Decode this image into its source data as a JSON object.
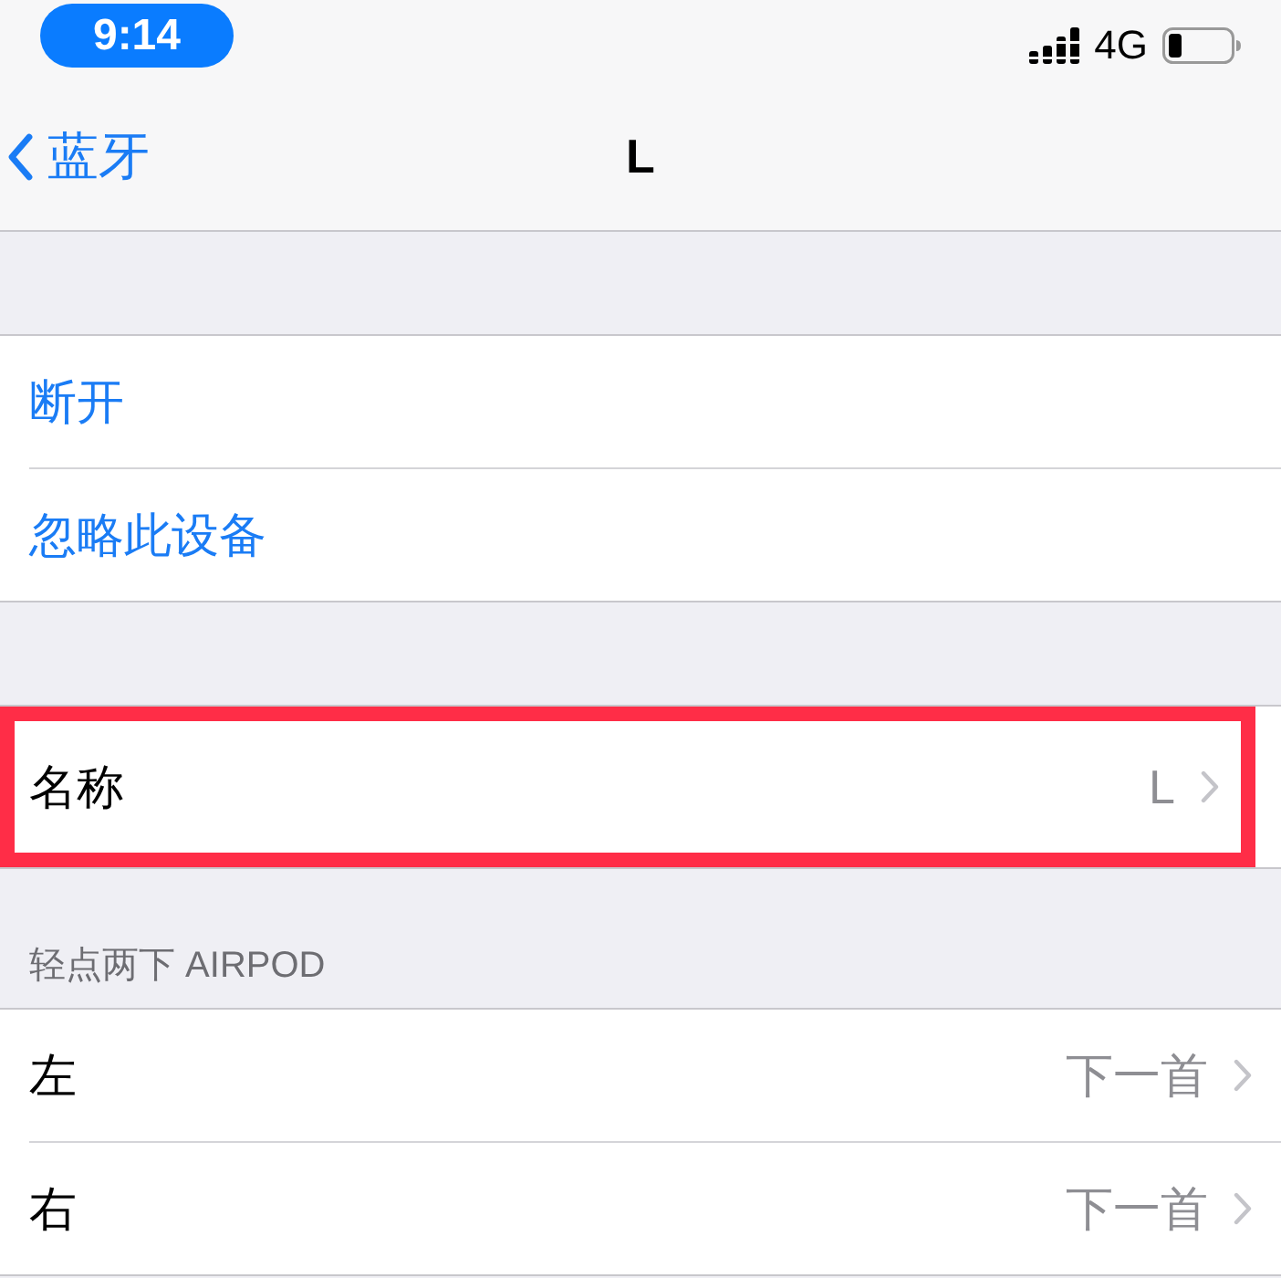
{
  "status_bar": {
    "time": "9:14",
    "network": "4G"
  },
  "nav_bar": {
    "back_label": "蓝牙",
    "title": "L"
  },
  "sections": [
    {
      "rows": [
        {
          "kind": "action",
          "label": "断开",
          "highlighted": false
        },
        {
          "kind": "action",
          "label": "忽略此设备",
          "highlighted": false
        }
      ]
    },
    {
      "rows": [
        {
          "kind": "disclosure",
          "label": "名称",
          "value": "L",
          "highlighted": true
        }
      ]
    },
    {
      "header": "轻点两下 AIRPOD",
      "rows": [
        {
          "kind": "disclosure",
          "label": "左",
          "value": "下一首",
          "highlighted": false
        },
        {
          "kind": "disclosure",
          "label": "右",
          "value": "下一首",
          "highlighted": false
        }
      ]
    }
  ]
}
